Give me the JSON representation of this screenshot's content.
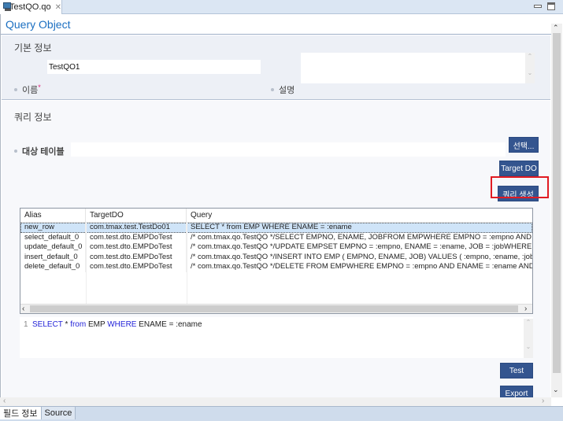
{
  "window": {
    "tab_label": "TestQO.qo",
    "tab_icon": "query-object-file-icon",
    "close_icon": "close-icon"
  },
  "header": {
    "title": "Query Object"
  },
  "basic_info": {
    "title": "기본 정보",
    "name_label": "이름",
    "required_mark": "*",
    "name_value": "TestQO1",
    "desc_label": "설명",
    "desc_value": ""
  },
  "query_info": {
    "title": "쿼리 정보",
    "target_table_label": "대상 테이블",
    "target_table_value": "",
    "select_button": "선택...",
    "target_do_button": "Target DO",
    "generate_query_button": "쿼리 생성"
  },
  "grid": {
    "columns": [
      "Alias",
      "TargetDO",
      "Query"
    ],
    "rows": [
      {
        "alias": "new_row",
        "target": "com.tmax.test.TestDo01",
        "query": "SELECT * from EMP WHERE ENAME = :ename",
        "selected": true
      },
      {
        "alias": "select_default_0",
        "target": "com.test.dto.EMPDoTest",
        "query": "/* com.tmax.qo.TestQO */SELECT    EMPNO,    ENAME,    JOBFROM    EMPWHERE        EMPNO = :empno    AND EN"
      },
      {
        "alias": "update_default_0",
        "target": "com.test.dto.EMPDoTest",
        "query": "/* com.tmax.qo.TestQO */UPDATE    EMPSET    EMPNO = :empno,    ENAME = :ename,    JOB = :jobWHERE    EMP.."
      },
      {
        "alias": "insert_default_0",
        "target": "com.test.dto.EMPDoTest",
        "query": "/* com.tmax.qo.TestQO */INSERT INTO EMP (    EMPNO,    ENAME,    JOB) VALUES (    :empno,    :ename,    :job)"
      },
      {
        "alias": "delete_default_0",
        "target": "com.test.dto.EMPDoTest",
        "query": "/* com.tmax.qo.TestQO */DELETE FROM EMPWHERE    EMPNO = :empno    AND ENAME = :ename    AND JOB = :jo"
      }
    ]
  },
  "editor": {
    "line_number": "1",
    "tokens": [
      {
        "text": "SELECT",
        "kw": true
      },
      {
        "text": " * ",
        "kw": false
      },
      {
        "text": "from",
        "kw": true
      },
      {
        "text": " EMP ",
        "kw": false
      },
      {
        "text": "WHERE",
        "kw": true
      },
      {
        "text": " ENAME = :ename",
        "kw": false
      }
    ],
    "keyword_color": "#2323d8"
  },
  "actions": {
    "test_button": "Test",
    "export_button": "Export"
  },
  "bottom_tabs": [
    {
      "label": "필드 정보",
      "active": true
    },
    {
      "label": "Source",
      "active": false
    }
  ],
  "colors": {
    "accent": "#34558f",
    "title": "#1b6fc1",
    "highlight": "#e11b22",
    "selected_row": "#cfe4f8"
  }
}
